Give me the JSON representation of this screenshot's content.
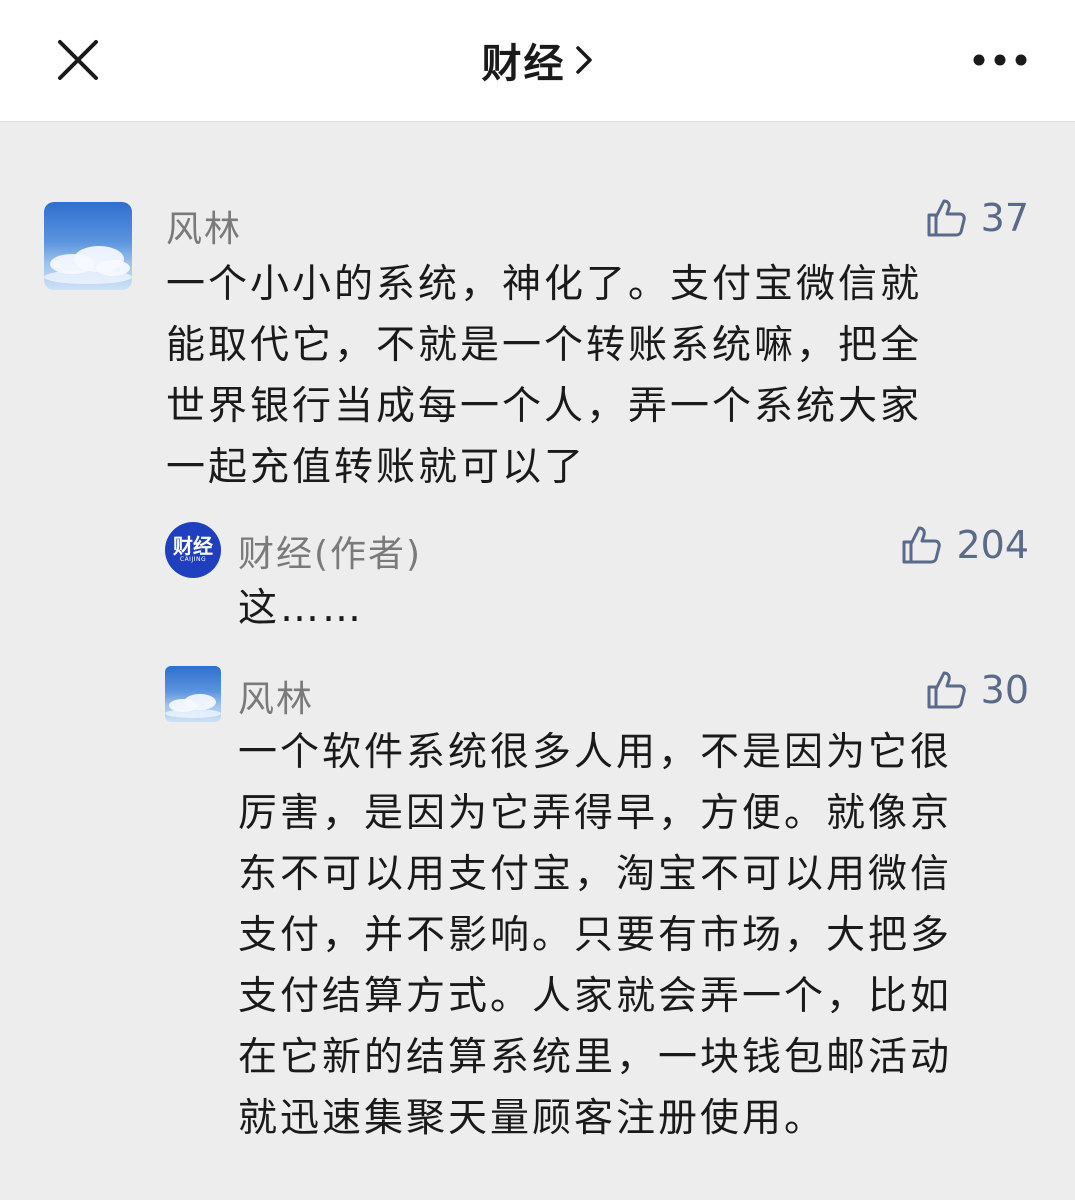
{
  "header": {
    "title": "财经",
    "close_icon": "close-icon",
    "chevron_icon": "chevron-right-icon",
    "more_icon": "more-icon"
  },
  "comments": [
    {
      "author": "风林",
      "likes": "37",
      "text_lines": [
        "一个小小的系统，神化了。支付宝微信就",
        "能取代它，不就是一个转账系统嘛，把全",
        "世界银行当成每一个人，弄一个系统大家",
        "一起充值转账就可以了"
      ]
    },
    {
      "author": "财经(作者)",
      "logo_main": "财经",
      "logo_sub": "CAIJING",
      "likes": "204",
      "text_lines": [
        "这……"
      ]
    },
    {
      "author": "风林",
      "likes": "30",
      "text_lines": [
        "一个软件系统很多人用，不是因为它很",
        "厉害，是因为它弄得早，方便。就像京",
        "东不可以用支付宝，淘宝不可以用微信",
        "支付，并不影响。只要有市场，大把多",
        "支付结算方式。人家就会弄一个，比如",
        "在它新的结算系统里，一块钱包邮活动",
        "就迅速集聚天量顾客注册使用。"
      ]
    }
  ],
  "colors": {
    "background": "#ededed",
    "header_bg": "#ffffff",
    "author": "#7a7a7a",
    "like": "#5a6a8a",
    "text": "#1a1a1a",
    "logo": "#1f3fbf"
  }
}
